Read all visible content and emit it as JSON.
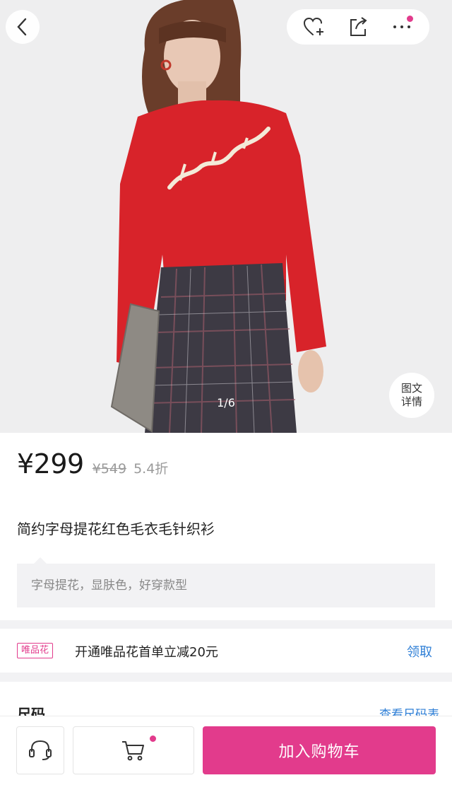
{
  "gallery": {
    "counter": "1/6",
    "detail_line1": "图文",
    "detail_line2": "详情"
  },
  "product": {
    "price": "¥299",
    "original_price": "¥549",
    "discount": "5.4折",
    "title": "简约字母提花红色毛衣毛针织衫",
    "description": "字母提花，显肤色，好穿款型"
  },
  "promo": {
    "tag": "唯品花",
    "text": "开通唯品花首单立减20元",
    "link": "领取"
  },
  "size": {
    "label": "尺码",
    "link": "查看尺码表"
  },
  "bottom_bar": {
    "add_to_cart": "加入购物车"
  },
  "colors": {
    "accent": "#e23b8c",
    "link": "#2f7fd6",
    "sweater": "#d8232a"
  },
  "icons": [
    "back-arrow-icon",
    "heart-plus-icon",
    "share-icon",
    "more-icon",
    "headset-icon",
    "cart-icon"
  ]
}
